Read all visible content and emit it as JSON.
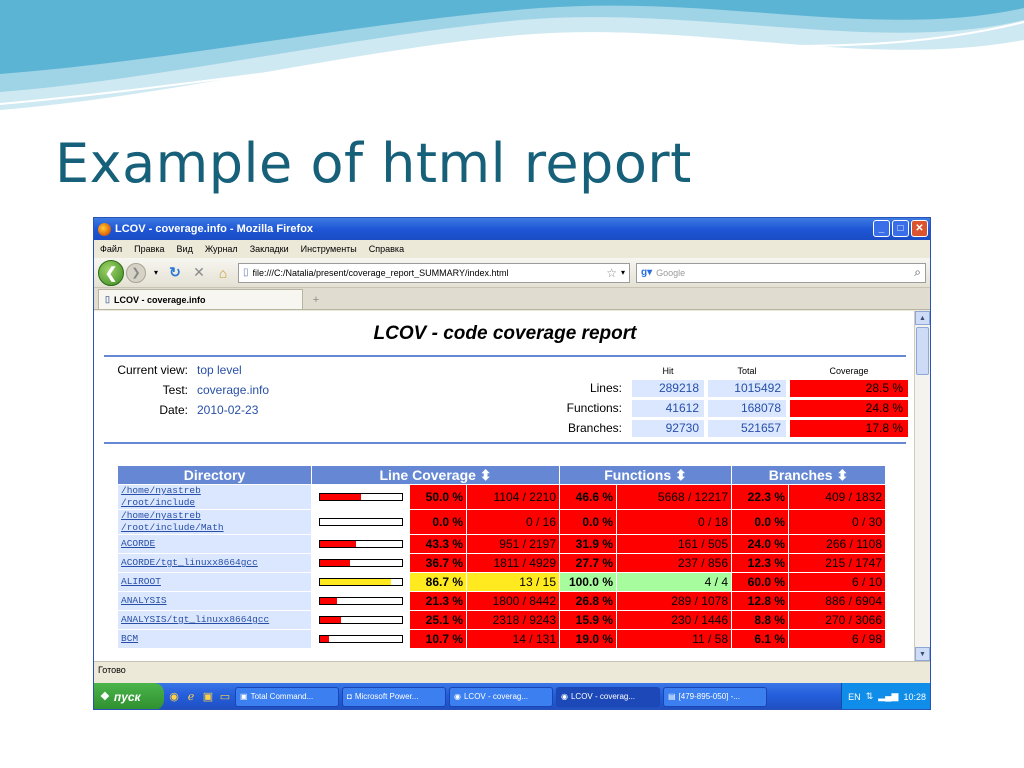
{
  "slide": {
    "title": "Example of html report"
  },
  "window": {
    "title": "LCOV - coverage.info - Mozilla Firefox",
    "menu": [
      "Файл",
      "Правка",
      "Вид",
      "Журнал",
      "Закладки",
      "Инструменты",
      "Справка"
    ],
    "url": "file:///C:/Natalia/present/coverage_report_SUMMARY/index.html",
    "search_placeholder": "Google",
    "tab_label": "LCOV - coverage.info",
    "new_tab": "+",
    "status": "Готово"
  },
  "report": {
    "title": "LCOV - code coverage report",
    "current_view_label": "Current view:",
    "current_view": "top level",
    "test_label": "Test:",
    "test": "coverage.info",
    "date_label": "Date:",
    "date": "2010-02-23",
    "col_hit": "Hit",
    "col_total": "Total",
    "col_coverage": "Coverage",
    "summary": [
      {
        "label": "Lines:",
        "hit": "289218",
        "total": "1015492",
        "coverage": "28.5 %"
      },
      {
        "label": "Functions:",
        "hit": "41612",
        "total": "168078",
        "coverage": "24.8 %"
      },
      {
        "label": "Branches:",
        "hit": "92730",
        "total": "521657",
        "coverage": "17.8 %"
      }
    ],
    "table_headers": {
      "directory": "Directory",
      "line": "Line Coverage ⬍",
      "functions": "Functions ⬍",
      "branches": "Branches ⬍"
    },
    "rows": [
      {
        "dir1": "/home/nyastreb",
        "dir2": "/root/include",
        "line_fill": 0.5,
        "line_pct": "50.0 %",
        "line_abs": "1104 / 2210",
        "line_cls": "cLo",
        "func_pct": "46.6 %",
        "func_abs": "5668 / 12217",
        "func_cls": "cLo",
        "br_pct": "22.3 %",
        "br_abs": "409 / 1832",
        "br_cls": "cLo"
      },
      {
        "dir1": "/home/nyastreb",
        "dir2": "/root/include/Math",
        "line_fill": 0.0,
        "line_pct": "0.0 %",
        "line_abs": "0 / 16",
        "line_cls": "cLo",
        "func_pct": "0.0 %",
        "func_abs": "0 / 18",
        "func_cls": "cLo",
        "br_pct": "0.0 %",
        "br_abs": "0 / 30",
        "br_cls": "cLo"
      },
      {
        "dir1": "ACORDE",
        "dir2": "",
        "line_fill": 0.433,
        "line_pct": "43.3 %",
        "line_abs": "951 / 2197",
        "line_cls": "cLo",
        "func_pct": "31.9 %",
        "func_abs": "161 / 505",
        "func_cls": "cLo",
        "br_pct": "24.0 %",
        "br_abs": "266 / 1108",
        "br_cls": "cLo"
      },
      {
        "dir1": "ACORDE/tgt_linuxx8664gcc",
        "dir2": "",
        "line_fill": 0.367,
        "line_pct": "36.7 %",
        "line_abs": "1811 / 4929",
        "line_cls": "cLo",
        "func_pct": "27.7 %",
        "func_abs": "237 / 856",
        "func_cls": "cLo",
        "br_pct": "12.3 %",
        "br_abs": "215 / 1747",
        "br_cls": "cLo"
      },
      {
        "dir1": "ALIROOT",
        "dir2": "",
        "line_fill": 0.867,
        "line_pct": "86.7 %",
        "line_abs": "13 / 15",
        "line_cls": "cMed",
        "func_pct": "100.0 %",
        "func_abs": "4 / 4",
        "func_cls": "cHi",
        "br_pct": "60.0 %",
        "br_abs": "6 / 10",
        "br_cls": "cLo"
      },
      {
        "dir1": "ANALYSIS",
        "dir2": "",
        "line_fill": 0.213,
        "line_pct": "21.3 %",
        "line_abs": "1800 / 8442",
        "line_cls": "cLo",
        "func_pct": "26.8 %",
        "func_abs": "289 / 1078",
        "func_cls": "cLo",
        "br_pct": "12.8 %",
        "br_abs": "886 / 6904",
        "br_cls": "cLo"
      },
      {
        "dir1": "ANALYSIS/tgt_linuxx8664gcc",
        "dir2": "",
        "line_fill": 0.251,
        "line_pct": "25.1 %",
        "line_abs": "2318 / 9243",
        "line_cls": "cLo",
        "func_pct": "15.9 %",
        "func_abs": "230 / 1446",
        "func_cls": "cLo",
        "br_pct": "8.8 %",
        "br_abs": "270 / 3066",
        "br_cls": "cLo"
      },
      {
        "dir1": "BCM",
        "dir2": "",
        "line_fill": 0.107,
        "line_pct": "10.7 %",
        "line_abs": "14 / 131",
        "line_cls": "cLo",
        "func_pct": "19.0 %",
        "func_abs": "11 / 58",
        "func_cls": "cLo",
        "br_pct": "6.1 %",
        "br_abs": "6 / 98",
        "br_cls": "cLo"
      }
    ]
  },
  "taskbar": {
    "start": "пуск",
    "tasks": [
      "Total Command...",
      "Microsoft Power...",
      "LCOV - coverag...",
      "LCOV - coverag...",
      "[479-895-050] -..."
    ],
    "lang": "EN",
    "clock": "10:28"
  },
  "colors": {
    "header_blue": "#6688d4",
    "low": "#ff0000",
    "medium": "#ffea20",
    "high": "#a7fc9d",
    "cell": "#dae7fe"
  },
  "icons": [
    "firefox-icon",
    "back-arrow-icon",
    "forward-arrow-icon",
    "reload-icon",
    "stop-icon",
    "home-icon",
    "page-icon",
    "star-icon",
    "search-icon",
    "windows-flag-icon"
  ]
}
